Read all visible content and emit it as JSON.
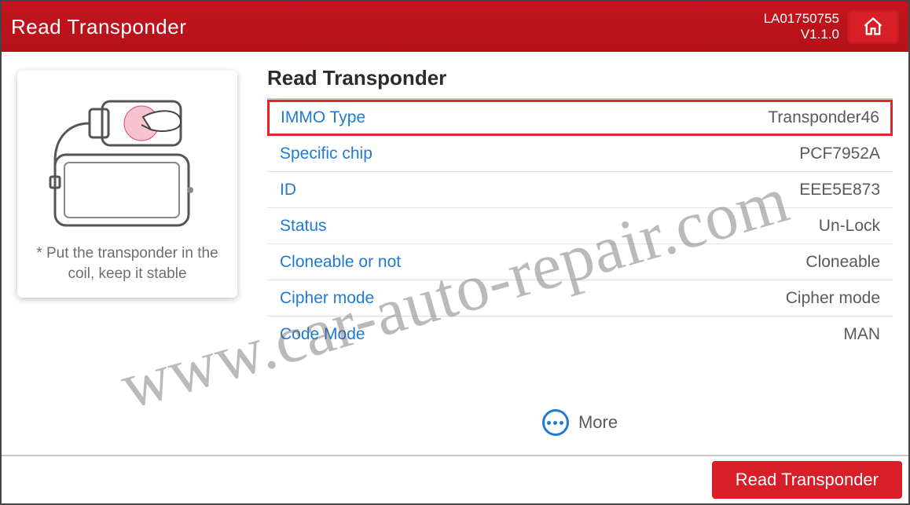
{
  "header": {
    "title": "Read Transponder",
    "device_id": "LA01750755",
    "version": "V1.1.0"
  },
  "left": {
    "caption": "* Put the transponder in the coil, keep it stable"
  },
  "main": {
    "section_title": "Read Transponder",
    "rows": [
      {
        "label": "IMMO Type",
        "value": "Transponder46",
        "selected": true
      },
      {
        "label": "Specific chip",
        "value": "PCF7952A"
      },
      {
        "label": "ID",
        "value": "EEE5E873"
      },
      {
        "label": "Status",
        "value": "Un-Lock"
      },
      {
        "label": "Cloneable or not",
        "value": "Cloneable"
      },
      {
        "label": "Cipher mode",
        "value": "Cipher mode"
      },
      {
        "label": "Code Mode",
        "value": "MAN"
      }
    ],
    "more_label": "More"
  },
  "footer": {
    "read_button_label": "Read Transponder"
  },
  "watermark": "www.car-auto-repair.com"
}
